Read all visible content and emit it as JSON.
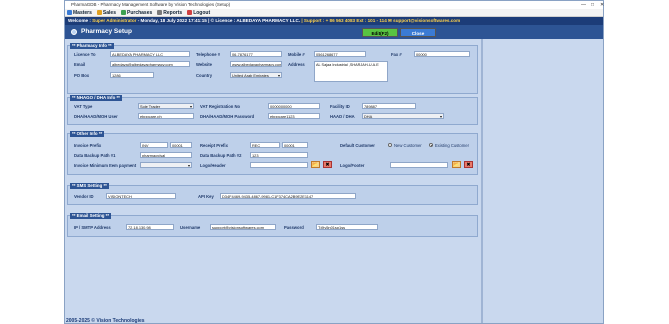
{
  "window": {
    "title": "PharmaGDB - Pharmacy Management Software by Vision Technologies (Setup)",
    "min": "—",
    "max": "□",
    "close": "✕"
  },
  "menu": {
    "items": [
      {
        "label": "Masters",
        "color": "#3a7bd5"
      },
      {
        "label": "Sales",
        "color": "#e0a020"
      },
      {
        "label": "Purchases",
        "color": "#3ca050"
      },
      {
        "label": "Reports",
        "color": "#7a7a7a"
      },
      {
        "label": "Logout",
        "color": "#d04040"
      }
    ]
  },
  "welcome": {
    "prefix": "Welcome : ",
    "user": "Super Administrator",
    "date": " - Monday, 18 July 2022 17:41:15 ",
    "licence": "| © Licence : ALBEDAYA PHARMACY LLC. ",
    "support": "| Support : + 86 563 4083 Ext : 101 - 114  ✉ support@visionsoftwares.com"
  },
  "header": {
    "title": "Pharmacy Setup",
    "edit": "Edit(F2)",
    "close": "Close"
  },
  "pharmacy": {
    "heading": "** Pharmacy Info **",
    "licence_label": "Licence To",
    "licence": "ALBEDAYA PHARMACY LLC",
    "telephone_label": "Telephone #",
    "telephone": "06-7876177",
    "mobile_label": "Mobile #",
    "mobile": "0561268677",
    "fax_label": "Fax #",
    "fax": "00000",
    "email_label": "Email",
    "email": "albedaya@albedayapharmacy.com",
    "website_label": "Website",
    "website": "www.albedayapharmacy.com",
    "address_label": "Address",
    "address": "AL Sajaa Industrial ,SHARJAH-U.A.E",
    "pobox_label": "PO Box",
    "pobox": "1286",
    "country_label": "Country",
    "country": "United Arab Emirates"
  },
  "vat": {
    "heading": "** NHAGO / DHA Info **",
    "type_label": "VAT Type",
    "type": "Sole Trader",
    "reg_label": "VAT Registration No",
    "reg": "0000000000",
    "facility_label": "Facility ID",
    "facility": "789887",
    "url_label": "DHA/HAAD/MOH User",
    "url": "ebppcare.ph",
    "pass_label": "DHA/HAAD/MOH Password",
    "pass": "ebppcare1123",
    "haad_label": "HAAD / DHA",
    "haad": "DHA"
  },
  "other": {
    "heading": "** Other Info **",
    "inv_label": "Invoice Prefix",
    "inv_a": "INV",
    "inv_b": "00001",
    "rec_label": "Receipt Prefix",
    "rec_a": "REC",
    "rec_b": "00001",
    "default_label": "Default Customer",
    "opt1": "New Customer",
    "opt2": "Existing Customer",
    "backup1_label": "Data Backup Path #1",
    "backup1": "pharmacy/sal",
    "backup2_label": "Data Backup Path #2",
    "backup2": "123",
    "min_label": "Invoice Minimum Item payment",
    "min": "",
    "logo_h_label": "Logo/Header",
    "logo_f_label": "Logo/Footer",
    "open_icon": "📂",
    "clear_icon": "✖"
  },
  "sms": {
    "heading": "** SMS Setting **",
    "vendor_label": "Vendor ID",
    "vendor": "VISIONTECH",
    "api_label": "API Key",
    "api": "D34F4469-9435-4867-9981-C1F374CA2B9E2E1147"
  },
  "email": {
    "heading": "** Email Setting **",
    "ip_label": "IP / SMTP Address",
    "ip": "72.18.130.98",
    "user_label": "Username",
    "user": "support@visionsoftwares.com",
    "pass_label": "Password",
    "pass": "T@v5n01sp1ss"
  },
  "footer": "2005-2025 © Vision Technologies"
}
